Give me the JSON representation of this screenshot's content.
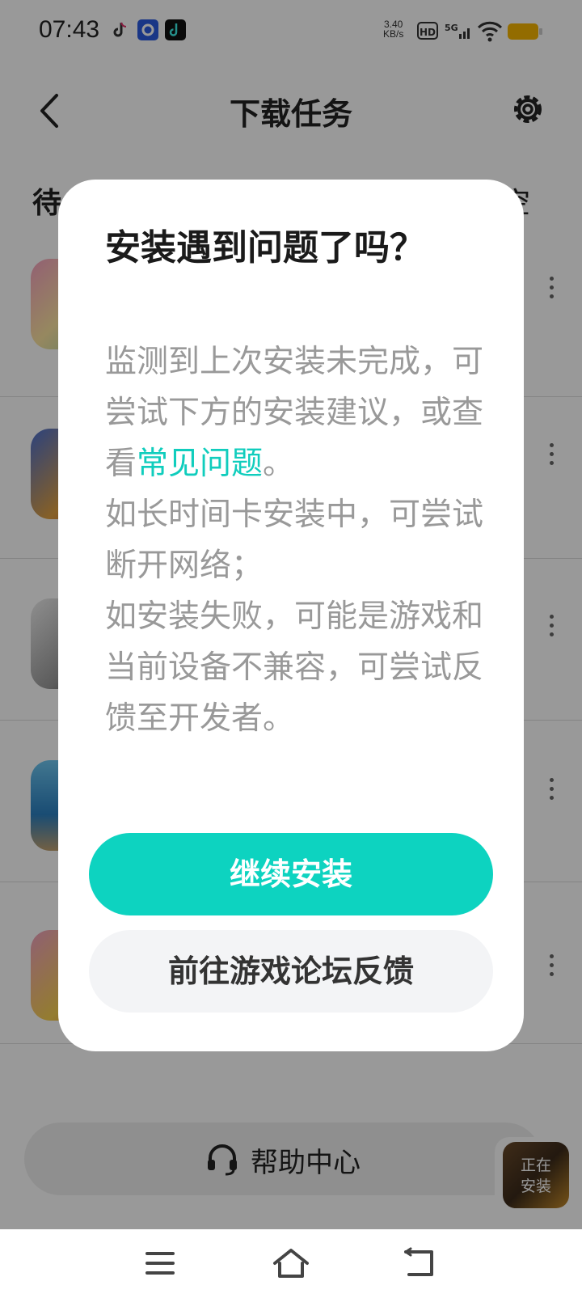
{
  "status_bar": {
    "time": "07:43",
    "net_speed_value": "3.40",
    "net_speed_unit": "KB/s",
    "hd": "HD",
    "signal": "5G",
    "battery_color": "#f5b400"
  },
  "header": {
    "title": "下载任务"
  },
  "section": {
    "left_label": "待",
    "right_label": "空"
  },
  "help": {
    "label": "帮助中心"
  },
  "installing": {
    "label_line1": "正在",
    "label_line2": "安装"
  },
  "dialog": {
    "title": "安装遇到问题了吗？",
    "body_part1": "监测到上次安装未完成，可尝试下方的安装建议，或查看",
    "body_link": "常见问题",
    "body_part2": "。",
    "body_line2": "如长时间卡安装中，可尝试断开网络；",
    "body_line3": "如安装失败，可能是游戏和当前设备不兼容，可尝试反馈至开发者。",
    "primary_button": "继续安装",
    "secondary_button": "前往游戏论坛反馈"
  },
  "colors": {
    "accent": "#0dd3c0",
    "link": "#10cdbd"
  }
}
